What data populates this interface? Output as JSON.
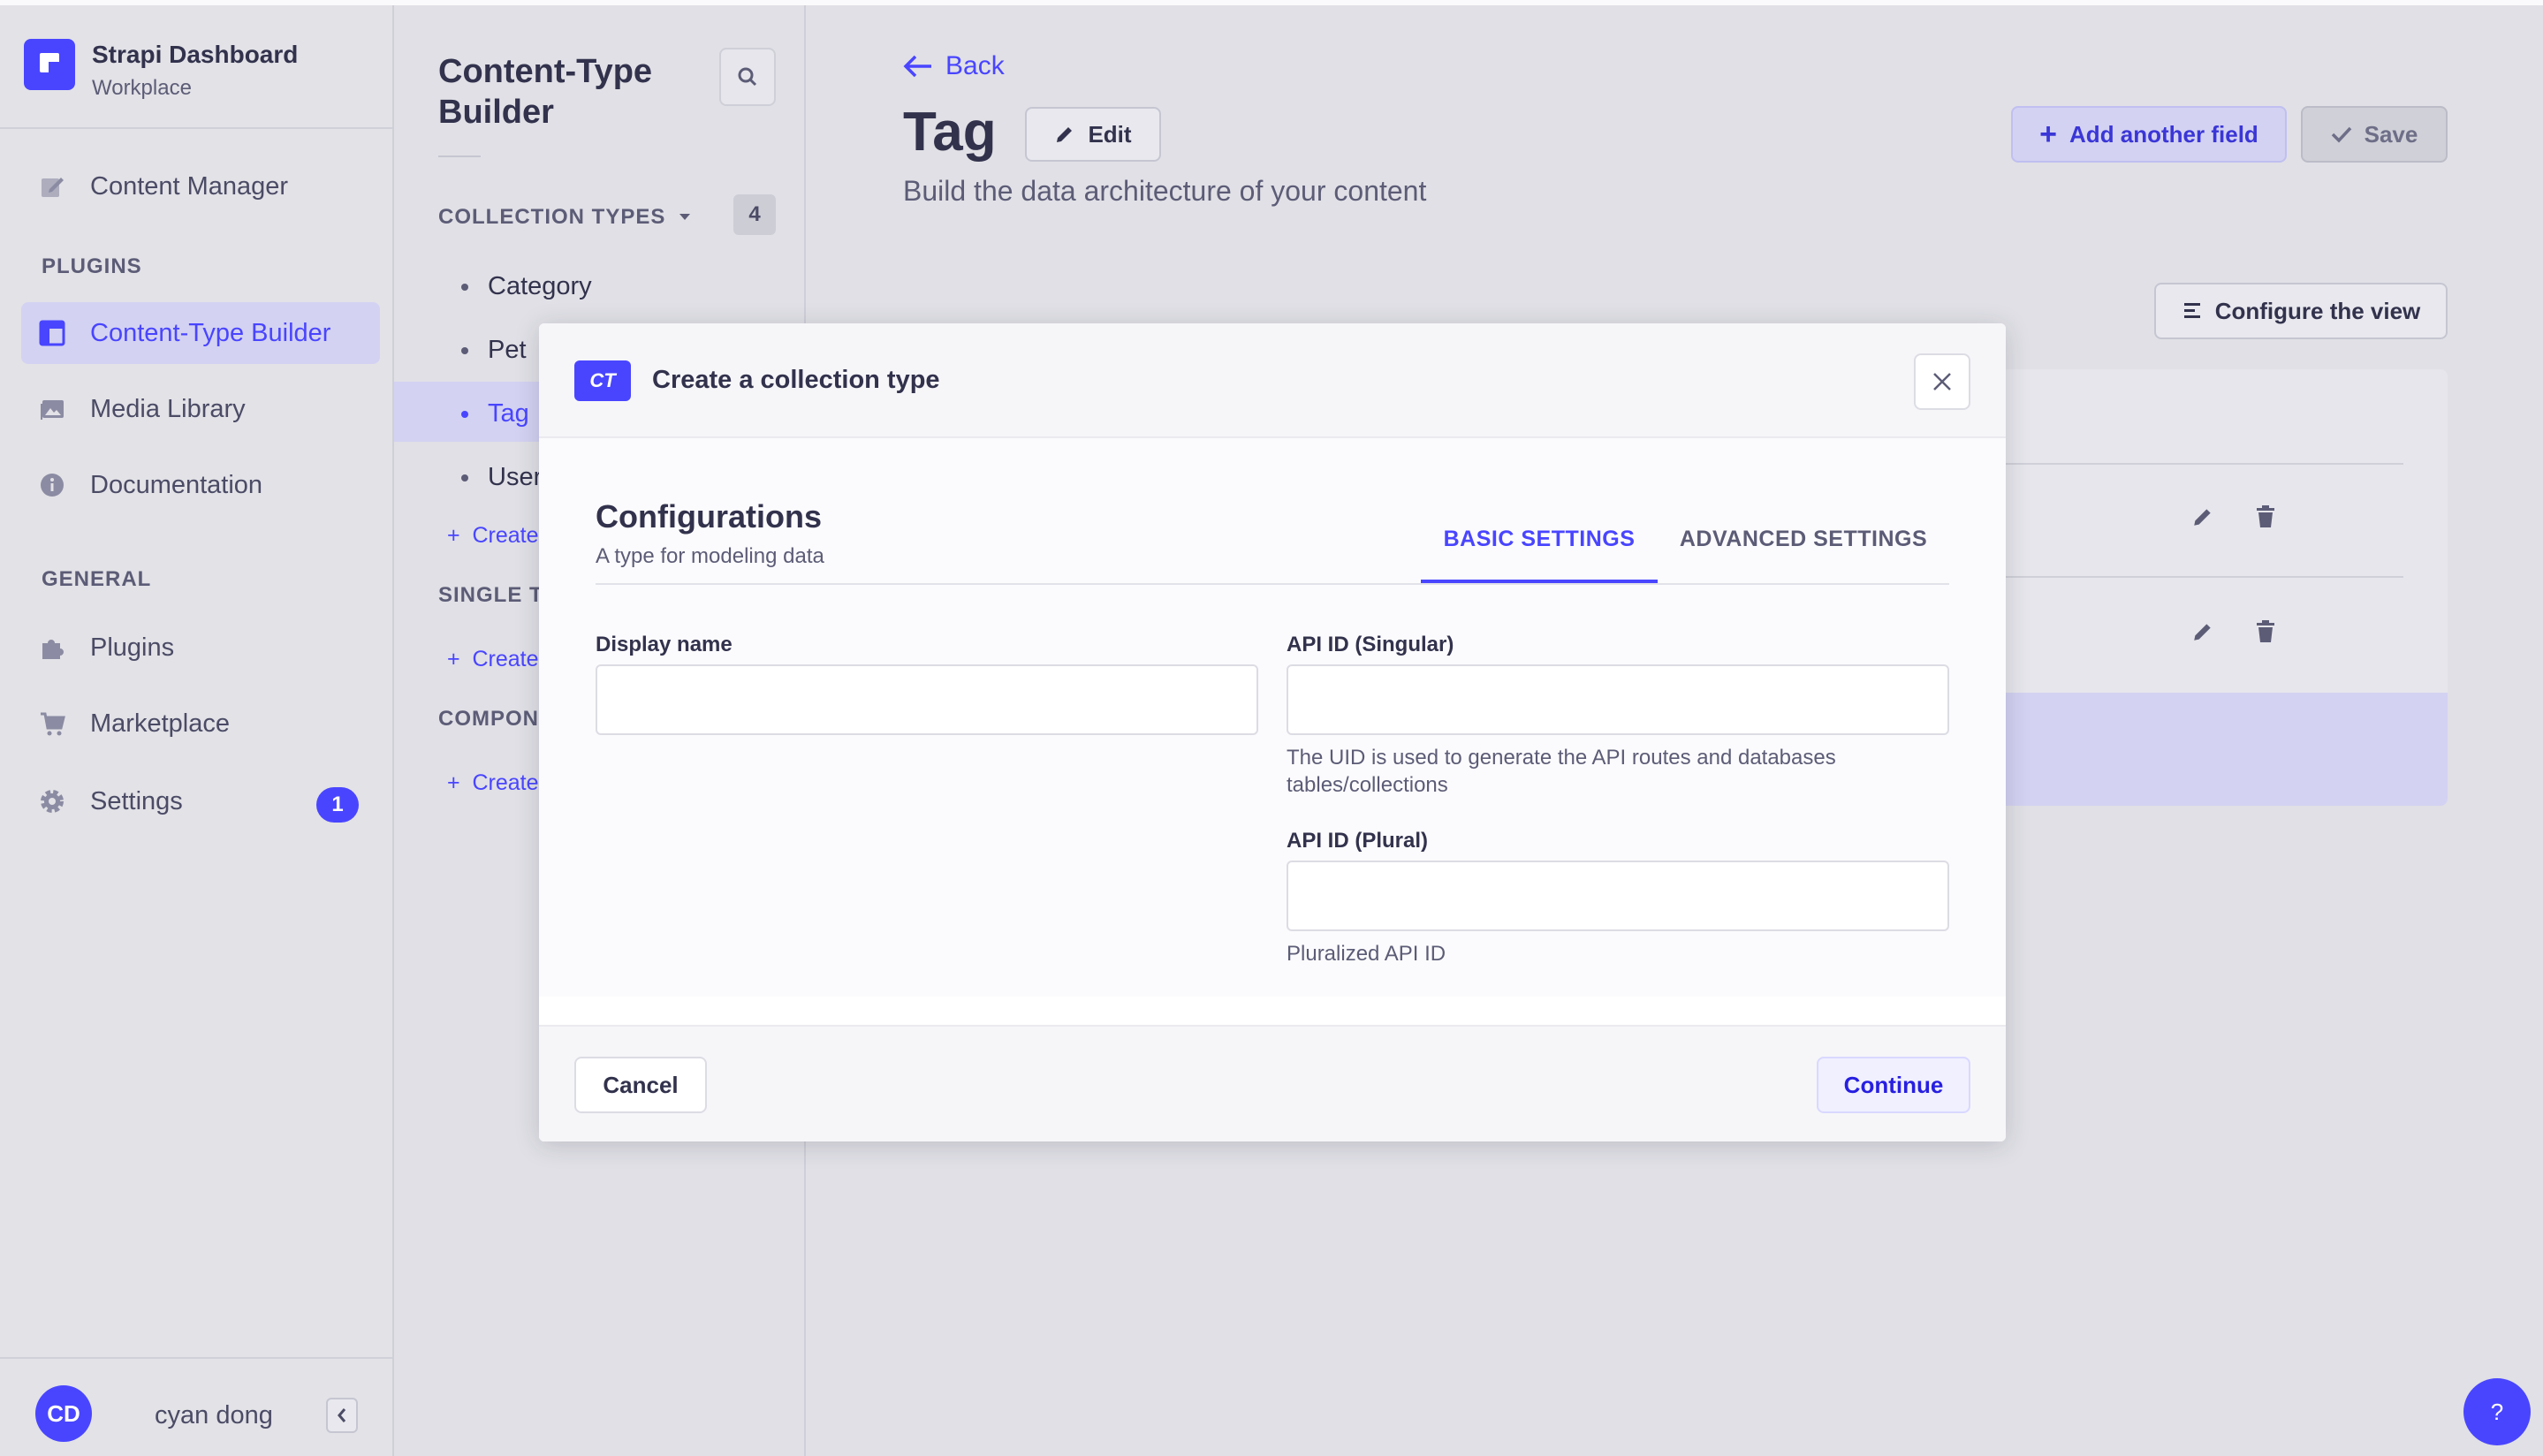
{
  "brand": {
    "title": "Strapi Dashboard",
    "subtitle": "Workplace"
  },
  "nav": {
    "items": [
      {
        "label": "Content Manager",
        "icon": "pencil-note-icon"
      },
      {
        "label": "Content-Type Builder",
        "icon": "layout-icon",
        "active": true
      },
      {
        "label": "Media Library",
        "icon": "image-icon"
      },
      {
        "label": "Documentation",
        "icon": "info-icon"
      },
      {
        "label": "Plugins",
        "icon": "puzzle-icon"
      },
      {
        "label": "Marketplace",
        "icon": "cart-icon"
      },
      {
        "label": "Settings",
        "icon": "gear-icon",
        "badge": "1"
      }
    ],
    "sections": {
      "plugins": "PLUGINS",
      "general": "GENERAL"
    },
    "user": {
      "initials": "CD",
      "name": "cyan dong"
    }
  },
  "subnav": {
    "title": "Content-Type Builder",
    "collection_types": {
      "label": "COLLECTION TYPES",
      "count": "4",
      "items": [
        "Category",
        "Pet",
        "Tag",
        "User"
      ],
      "create": "Create"
    },
    "single_types": {
      "label": "SINGLE T",
      "create": "Create"
    },
    "components": {
      "label": "COMPONE",
      "create": "Create"
    }
  },
  "main": {
    "back": "Back",
    "title": "Tag",
    "edit": "Edit",
    "subtitle": "Build the data architecture of your content",
    "add_field": "Add another field",
    "save": "Save",
    "configure_view": "Configure the view",
    "help": "?"
  },
  "modal": {
    "badge": "CT",
    "title": "Create a collection type",
    "config_title": "Configurations",
    "config_sub": "A type for modeling data",
    "tabs": [
      "BASIC SETTINGS",
      "ADVANCED SETTINGS"
    ],
    "display_name": {
      "label": "Display name",
      "value": ""
    },
    "api_singular": {
      "label": "API ID (Singular)",
      "value": "",
      "hint": "The UID is used to generate the API routes and databases tables/collections"
    },
    "api_plural": {
      "label": "API ID (Plural)",
      "value": "",
      "hint": "Pluralized API ID"
    },
    "cancel": "Cancel",
    "continue": "Continue"
  },
  "colors": {
    "accent": "#4945ff",
    "text": "#32324d",
    "muted": "#5c5c77"
  }
}
